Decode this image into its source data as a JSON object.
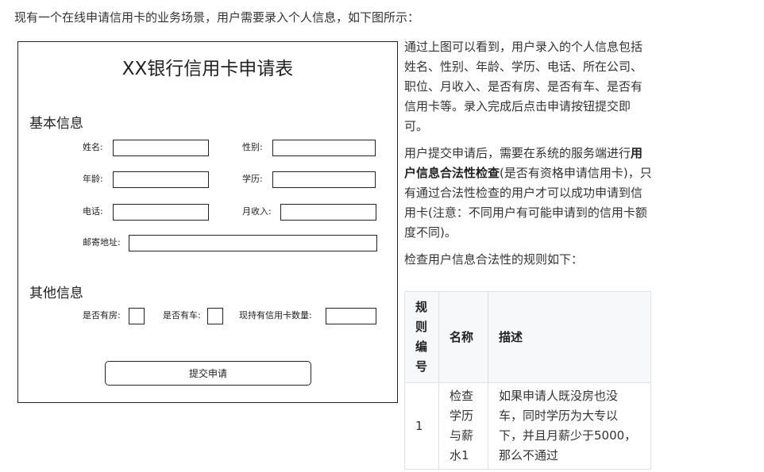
{
  "intro": "现有一个在线申请信用卡的业务场景，用户需要录入个人信息，如下图所示：",
  "form": {
    "title": "XX银行信用卡申请表",
    "basic_section": "基本信息",
    "other_section": "其他信息",
    "fields": {
      "name": "姓名:",
      "gender": "性别:",
      "age": "年龄:",
      "education": "学历:",
      "phone": "电话:",
      "income": "月收入:",
      "address": "邮寄地址:",
      "house": "是否有房:",
      "car": "是否有车:",
      "card_count": "现持有信用卡数量:"
    },
    "submit_label": "提交申请"
  },
  "right": {
    "p1": "通过上图可以看到，用户录入的个人信息包括姓名、性别、年龄、学历、电话、所在公司、职位、月收入、是否有房、是否有车、是否有信用卡等。录入完成后点击申请按钮提交即可。",
    "p2_before": "用户提交申请后，需要在系统的服务端进行",
    "p2_bold": "用户信息合法性检查",
    "p2_after": "(是否有资格申请信用卡)，只有通过合法性检查的用户才可以成功申请到信用卡(注意：不同用户有可能申请到的信用卡额度不同)。",
    "p3": "检查用户信息合法性的规则如下："
  },
  "table": {
    "headers": [
      "规则编号",
      "名称",
      "描述"
    ],
    "rows": [
      {
        "no": "1",
        "name": "检查学历与薪水1",
        "desc": "如果申请人既没房也没车，同时学历为大专以下，并且月薪少于5000，那么不通过"
      }
    ]
  }
}
